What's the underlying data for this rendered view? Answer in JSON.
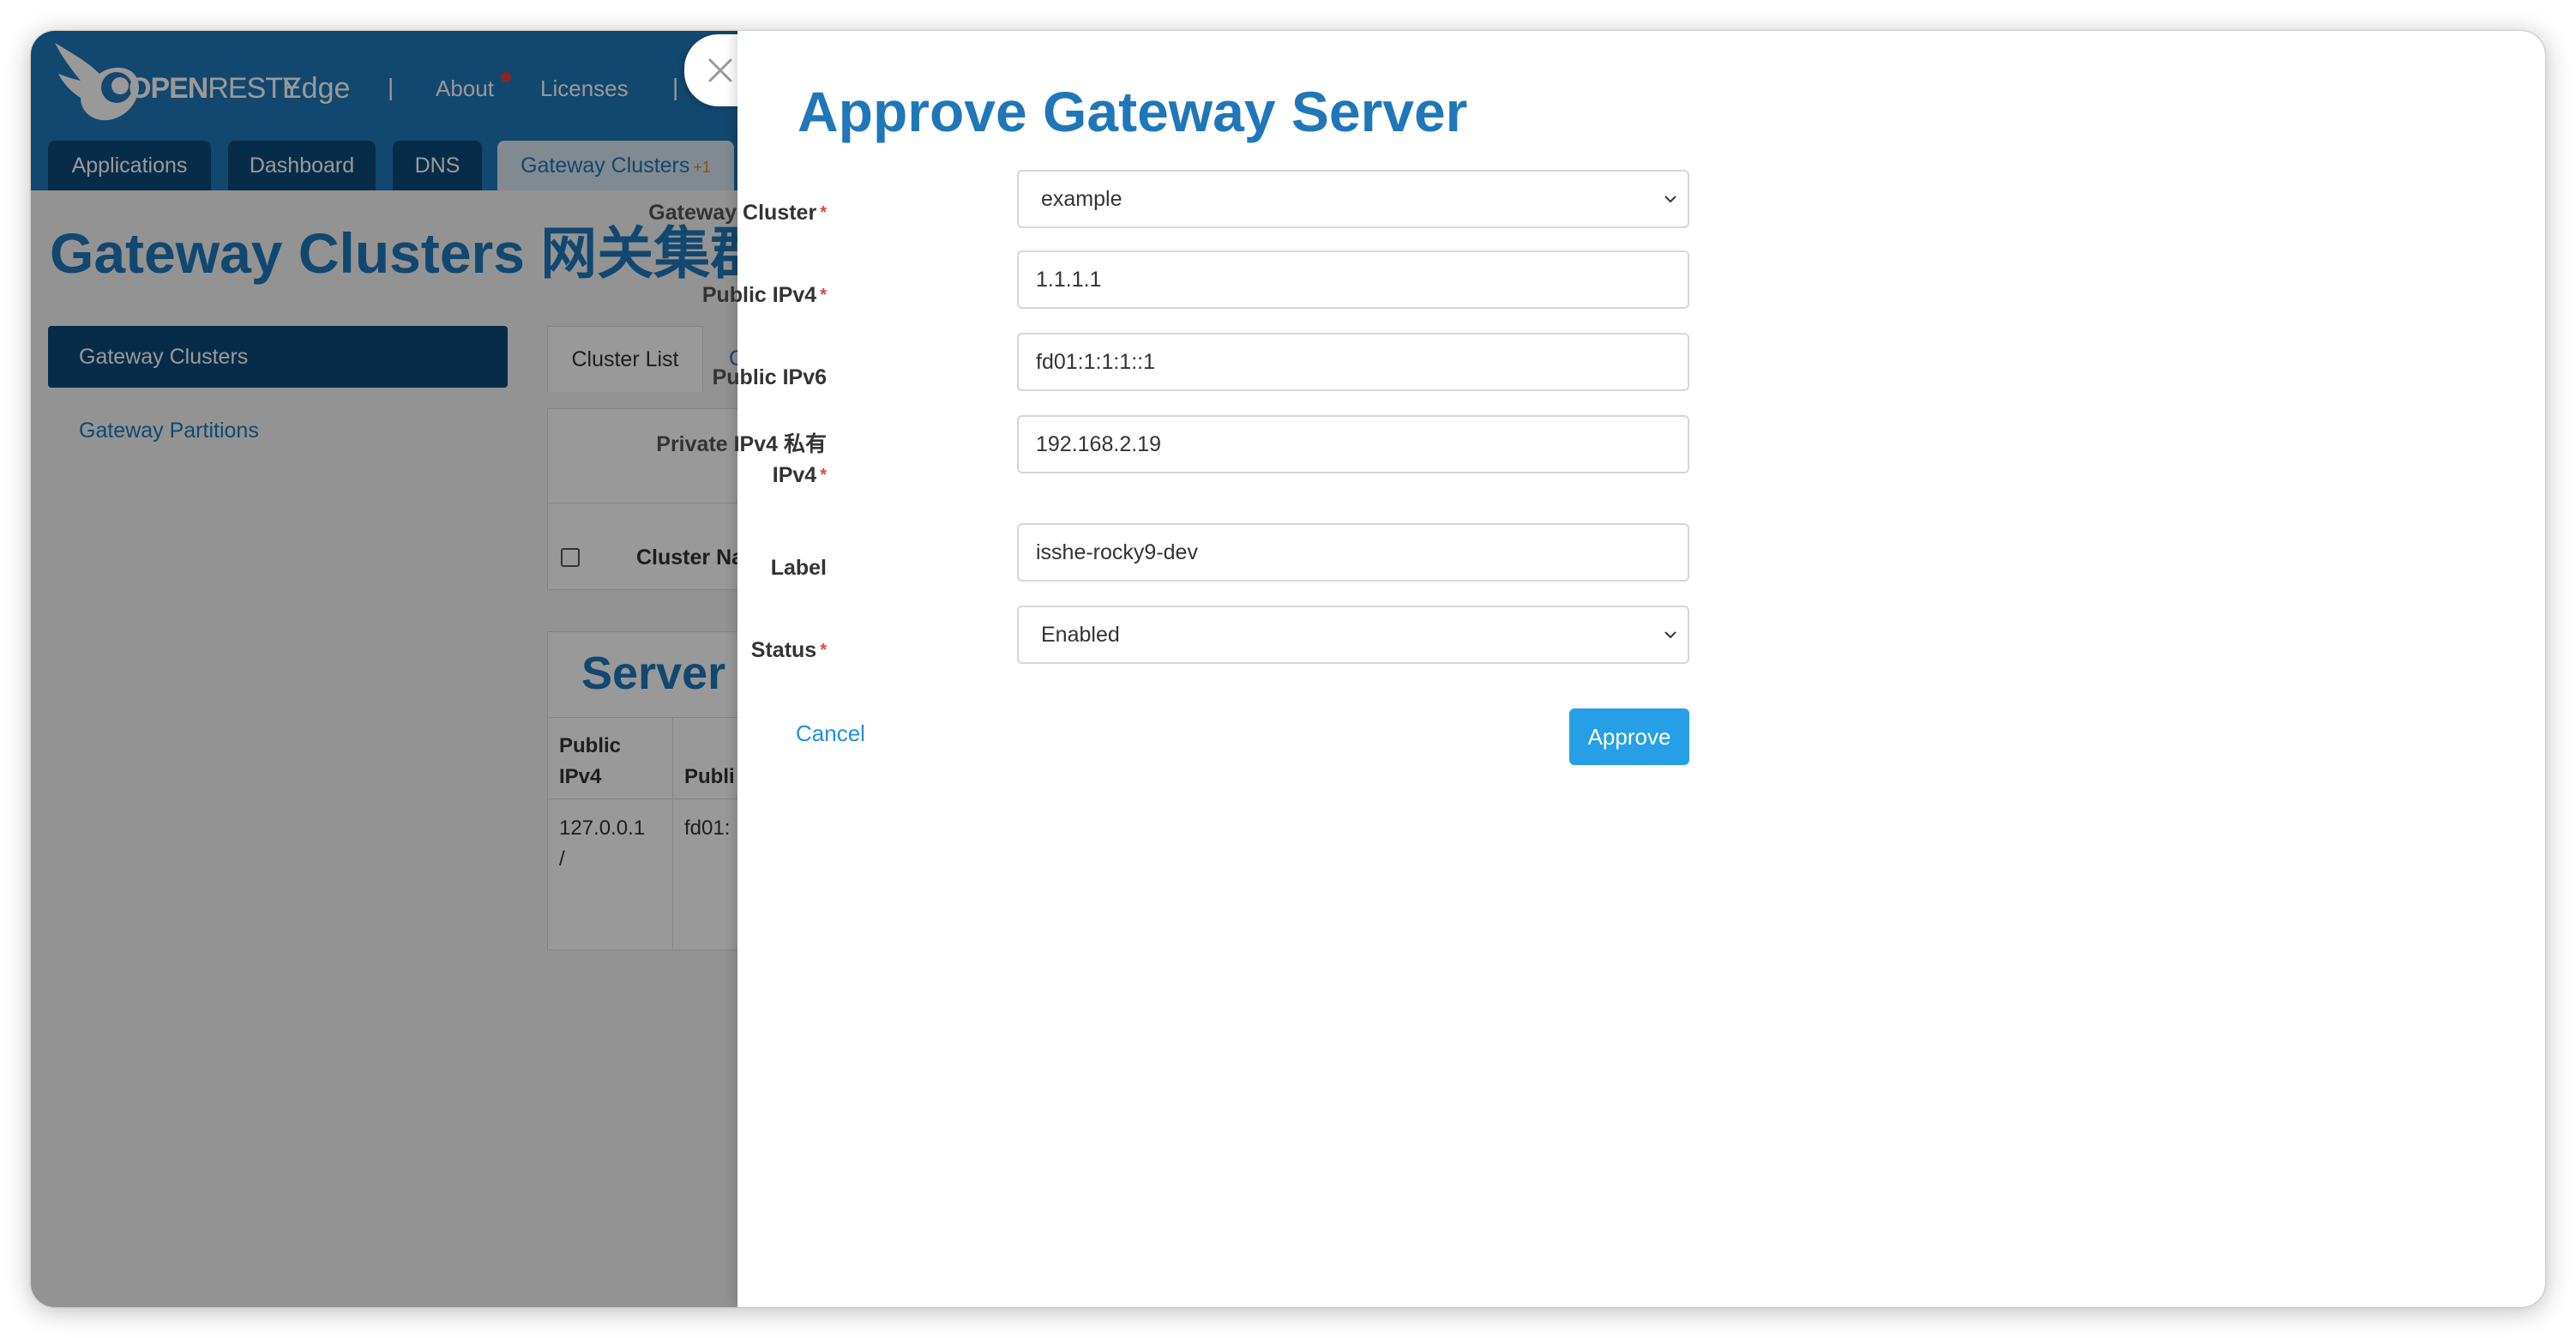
{
  "app": {
    "logo_open": "OPEN",
    "logo_resty": "RESTY",
    "product": "Edge",
    "nav_sep": "|",
    "nav": [
      "About",
      "Licenses"
    ]
  },
  "tabs": [
    {
      "label": "Applications"
    },
    {
      "label": "Dashboard"
    },
    {
      "label": "DNS"
    },
    {
      "label": "Gateway Clusters",
      "badge": "+1"
    }
  ],
  "page": {
    "title": "Gateway Clusters 网关集群",
    "sidebar": {
      "active": "Gateway Clusters",
      "link": "Gateway Partitions"
    },
    "subtab": "Cluster List",
    "subtab2": "C",
    "table_col": "Cluster Na",
    "server_title": "Server",
    "server_headers": [
      "Public IPv4",
      "Publi"
    ],
    "server_cells": [
      "127.0.0.1 /",
      "fd01:"
    ]
  },
  "modal": {
    "title": "Approve Gateway Server",
    "fields": [
      {
        "label": "Gateway Cluster",
        "value": "example",
        "required": "*"
      },
      {
        "label": "Public IPv4",
        "value": "1.1.1.1",
        "required": "*"
      },
      {
        "label": "Public IPv6",
        "value": "fd01:1:1:1::1",
        "required": ""
      },
      {
        "label": "Private IPv4  私有",
        "label2": "IPv4",
        "value": "192.168.2.19",
        "required": "*"
      },
      {
        "label": "Label",
        "value": "isshe-rocky9-dev",
        "required": ""
      },
      {
        "label": "Status",
        "value": "Enabled",
        "required": "*"
      }
    ],
    "cancel": "Cancel",
    "approve": "Approve"
  },
  "colors": {
    "primary": "#1f77b9",
    "dark_nav": "#0d4a7a",
    "approve": "#269fe6",
    "required": "#e2443b"
  }
}
